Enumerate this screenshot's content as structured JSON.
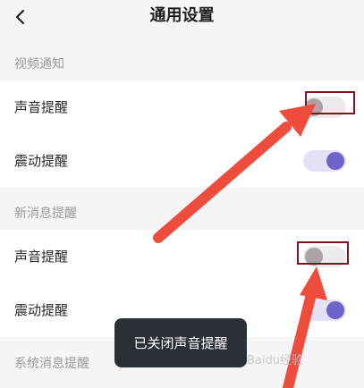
{
  "header": {
    "title": "通用设置"
  },
  "sections": {
    "video": {
      "title": "视频通知",
      "rows": [
        {
          "label": "声音提醒",
          "state": "off"
        },
        {
          "label": "震动提醒",
          "state": "on"
        }
      ]
    },
    "new_message": {
      "title": "新消息提醒",
      "rows": [
        {
          "label": "声音提醒",
          "state": "off"
        },
        {
          "label": "震动提醒",
          "state": "on"
        }
      ]
    },
    "system": {
      "title": "系统消息提醒"
    }
  },
  "toast": {
    "text": "已关闭声音提醒"
  },
  "watermark": {
    "text": "Baidu经验"
  },
  "colors": {
    "toggle_on_knob": "#6e63c9",
    "toggle_off_knob": "#a9a5a5",
    "annotation_arrow": "#ee4d3d",
    "annotation_box": "#7b1620"
  },
  "icons": {
    "back": "chevron-left-icon"
  }
}
